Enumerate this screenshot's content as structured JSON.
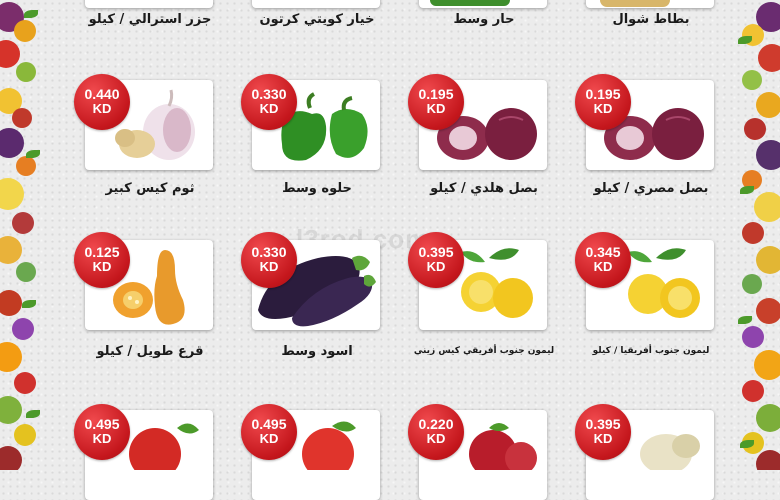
{
  "watermark": "l3rod.com",
  "top_row": [
    {
      "name": "جزر استرالي / كيلو"
    },
    {
      "name": "خيار كويتي كرتون"
    },
    {
      "name": "حار وسط"
    },
    {
      "name": "بطاط شوال"
    }
  ],
  "row1": [
    {
      "price": "0.440",
      "currency": "KD",
      "name": "ثوم كيس كبير",
      "icon": "garlic-icon"
    },
    {
      "price": "0.330",
      "currency": "KD",
      "name": "حلوه وسط",
      "icon": "green-pepper-icon"
    },
    {
      "price": "0.195",
      "currency": "KD",
      "name": "بصل هلدي / كيلو",
      "icon": "red-onion-icon"
    },
    {
      "price": "0.195",
      "currency": "KD",
      "name": "بصل مصري / كيلو",
      "icon": "red-onion-icon"
    }
  ],
  "row2": [
    {
      "price": "0.125",
      "currency": "KD",
      "name": "قرع طويل / كيلو",
      "icon": "butternut-squash-icon"
    },
    {
      "price": "0.330",
      "currency": "KD",
      "name": "اسود وسط",
      "icon": "eggplant-icon"
    },
    {
      "price": "0.395",
      "currency": "KD",
      "name": "ليمون جنوب أفريقي كيس زيني",
      "icon": "lemon-icon"
    },
    {
      "price": "0.345",
      "currency": "KD",
      "name": "ليمون جنوب أفريقيا / كيلو",
      "icon": "lemon-icon"
    }
  ],
  "row3": [
    {
      "price": "0.495",
      "currency": "KD",
      "icon": "red-apple-icon"
    },
    {
      "price": "0.495",
      "currency": "KD",
      "icon": "red-apple-icon"
    },
    {
      "price": "0.220",
      "currency": "KD",
      "icon": "pomegranate-icon"
    },
    {
      "price": "0.395",
      "currency": "KD",
      "icon": "produce-icon"
    }
  ],
  "colors": {
    "badge": "#d21f26",
    "card": "#ffffff",
    "background": "#ececec"
  }
}
